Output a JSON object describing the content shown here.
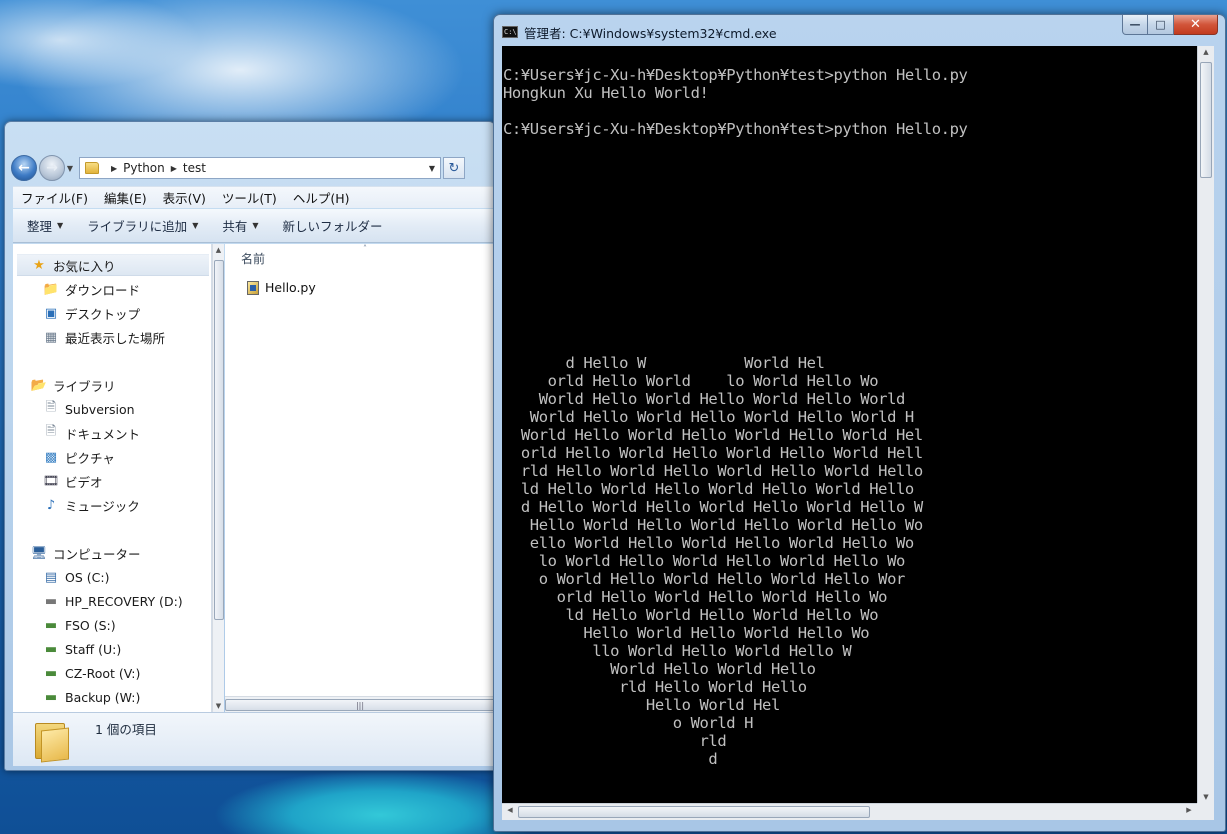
{
  "explorer": {
    "address": {
      "crumbs": [
        "Python",
        "test"
      ]
    },
    "menu": [
      "ファイル(F)",
      "編集(E)",
      "表示(V)",
      "ツール(T)",
      "ヘルプ(H)"
    ],
    "toolbar": {
      "organize": "整理",
      "add_to_library": "ライブラリに追加",
      "share": "共有",
      "new_folder": "新しいフォルダー"
    },
    "nav": {
      "favorites": "お気に入り",
      "downloads": "ダウンロード",
      "desktop": "デスクトップ",
      "recent": "最近表示した場所",
      "libraries": "ライブラリ",
      "subversion": "Subversion",
      "documents": "ドキュメント",
      "pictures": "ピクチャ",
      "videos": "ビデオ",
      "music": "ミュージック",
      "computer": "コンピューター",
      "drives": [
        "OS (C:)",
        "HP_RECOVERY (D:)",
        "FSO (S:)",
        "Staff (U:)",
        "CZ-Root (V:)",
        "Backup (W:)"
      ]
    },
    "column_name": "名前",
    "files": [
      "Hello.py"
    ],
    "details": {
      "item_count": "1 個の項目"
    }
  },
  "cmd": {
    "title": "管理者: C:¥Windows¥system32¥cmd.exe",
    "icon_text": "C:\\",
    "output": "C:¥Users¥jc-Xu-h¥Desktop¥Python¥test>python Hello.py\nHongkun Xu Hello World!\n\nC:¥Users¥jc-Xu-h¥Desktop¥Python¥test>python Hello.py\n\n\n\n\n\n\n\n\n\n\n\n\n       d Hello W           World Hel\n     orld Hello World    lo World Hello Wo\n    World Hello World Hello World Hello World\n   World Hello World Hello World Hello World H\n  World Hello World Hello World Hello World Hel\n  orld Hello World Hello World Hello World Hell\n  rld Hello World Hello World Hello World Hello\n  ld Hello World Hello World Hello World Hello\n  d Hello World Hello World Hello World Hello W\n   Hello World Hello World Hello World Hello Wo\n   ello World Hello World Hello World Hello Wo\n    lo World Hello World Hello World Hello Wo\n    o World Hello World Hello World Hello Wor\n      orld Hello World Hello World Hello Wo\n       ld Hello World Hello World Hello Wo\n         Hello World Hello World Hello Wo\n          llo World Hello World Hello W\n            World Hello World Hello\n             rld Hello World Hello\n                Hello World Hel\n                   o World H\n                      rld\n                       d"
  }
}
